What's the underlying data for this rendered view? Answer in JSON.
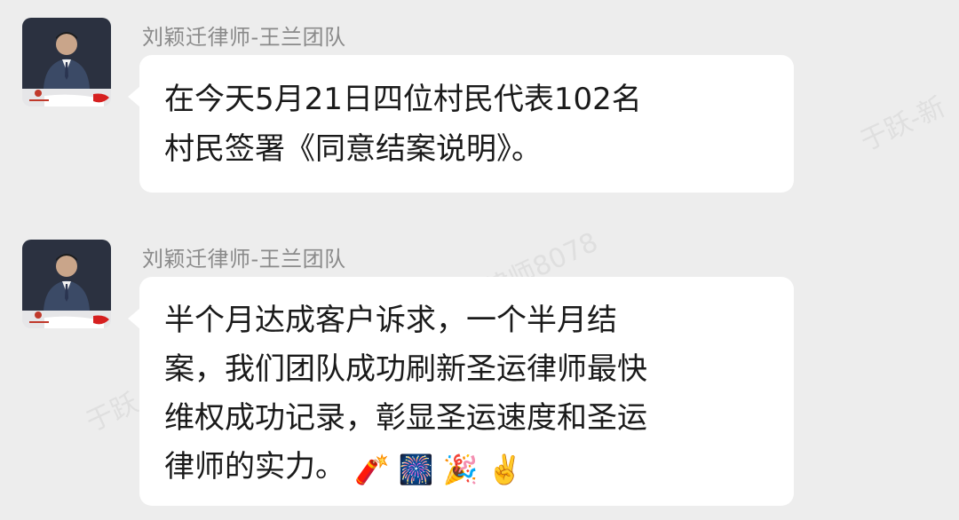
{
  "messages": [
    {
      "sender": "刘颖迁律师-王兰团队",
      "lines": [
        "在今天5月21日四位村民代表102名",
        "村民签署《同意结案说明》。"
      ],
      "emojis": []
    },
    {
      "sender": "刘颖迁律师-王兰团队",
      "lines": [
        "半个月达成客户诉求，一个半月结",
        "案，我们团队成功刷新圣运律师最快",
        "维权成功记录，彰显圣运速度和圣运",
        "律师的实力。"
      ],
      "emojis": [
        "🧨",
        "🎆",
        "🎉",
        "✌️"
      ]
    }
  ],
  "watermarks": [
    "于跃-新",
    "律师8078",
    "于跃"
  ],
  "colors": {
    "background": "#ededed",
    "bubble": "#ffffff",
    "sender_text": "#8a8a8a",
    "message_text": "#1a1a1a"
  }
}
